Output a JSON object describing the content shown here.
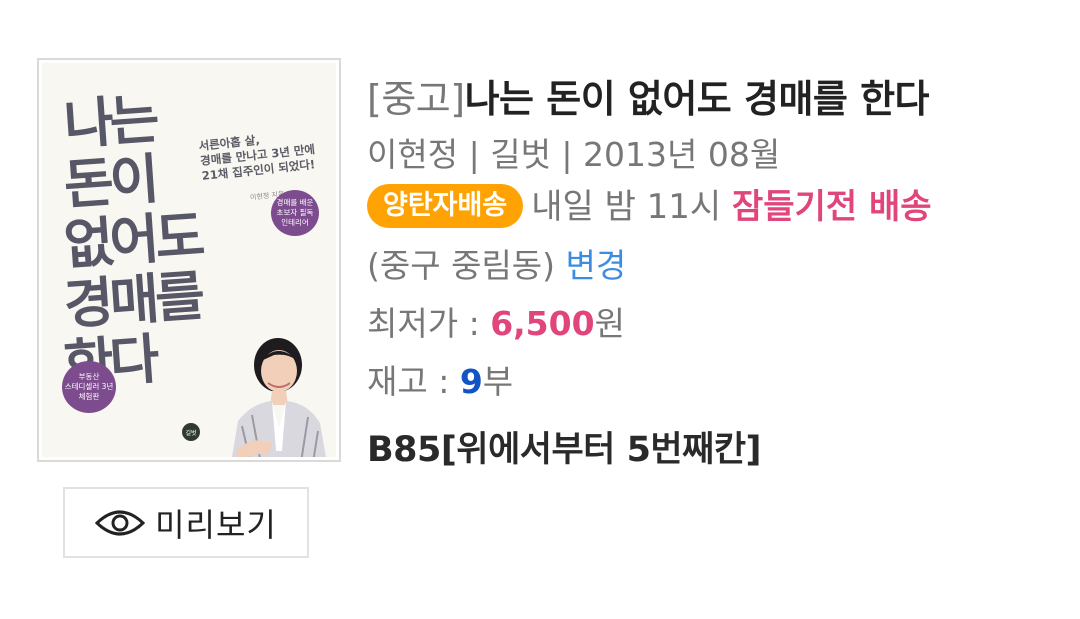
{
  "cover": {
    "title_lines": [
      "나는",
      "돈이",
      "없어도",
      "경매를",
      "한다"
    ],
    "subtitle": "서른아홉 살,\n경매를 만나고 3년 만에\n21채 집주인이 되었다!",
    "author": "이현정 지음",
    "badge_top": "경매를 배운\n초보자 필독\n인테리어",
    "badge_bottom": "부동산\n스테디셀러 3년\n체험판"
  },
  "preview": {
    "label": "미리보기",
    "icon": "eye-icon"
  },
  "book": {
    "condition": "[중고]",
    "title": "나는 돈이 없어도 경매를 한다",
    "author": "이현정",
    "separator": " | ",
    "publisher": "길벗",
    "pub_date": "2013년 08월"
  },
  "delivery": {
    "badge": "양탄자배송",
    "text": "내일 밤 11시 ",
    "highlight": "잠들기전 배송"
  },
  "location": {
    "area": "(중구 중림동) ",
    "change": "변경"
  },
  "price": {
    "label": "최저가 : ",
    "value": "6,500",
    "unit": "원"
  },
  "stock": {
    "label": "재고 : ",
    "value": "9",
    "unit": "부"
  },
  "shelf": "B85[위에서부터 5번째칸]",
  "colors": {
    "badge_orange": "#ffa305",
    "highlight_pink": "#e0457b",
    "link_blue": "#3d8ce3",
    "stock_blue": "#1254c4"
  }
}
